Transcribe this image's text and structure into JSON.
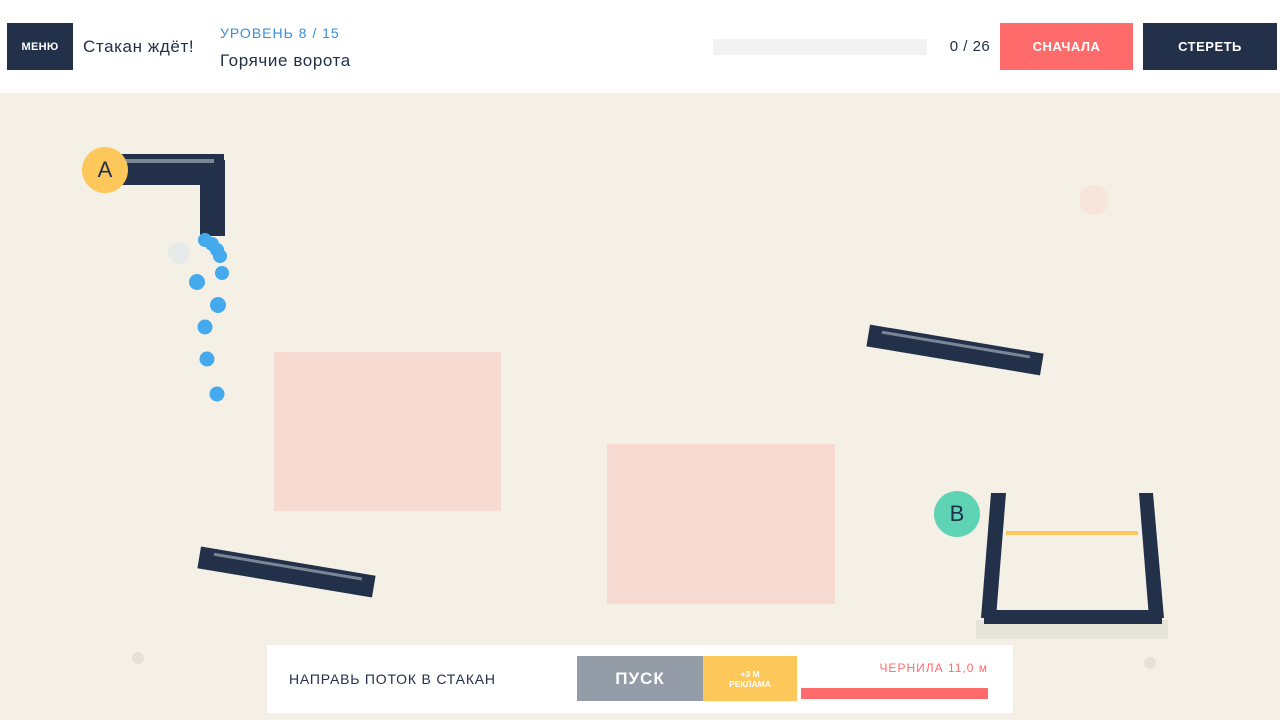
{
  "header": {
    "menu_label": "МЕНЮ",
    "status_text": "Стакан ждёт!",
    "level_number": "УРОВЕНЬ 8 / 15",
    "level_name": "Горячие ворота",
    "progress": {
      "count_text": "0 / 26",
      "filled": 0,
      "total": 26
    },
    "restart_label": "СНАЧАЛА",
    "erase_label": "СТЕРЕТЬ"
  },
  "field": {
    "marker_a_label": "A",
    "marker_b_label": "B",
    "colors": {
      "background": "#f5f0e6",
      "solid": "#223049",
      "water": "#45a9ee",
      "heat_zone": "#f7dbd3",
      "goal_line": "#fdc75a"
    }
  },
  "bottom": {
    "instruction": "НАПРАВЬ ПОТОК В СТАКАН",
    "play_label": "ПУСК",
    "ad_line1": "+3 М",
    "ad_line2": "РЕКЛАМА",
    "ink_label": "ЧЕРНИЛА  11,0 м",
    "ink_fraction": 1.0
  },
  "colors": {
    "dark": "#223049",
    "accent_red": "#ff6b6b",
    "accent_yellow": "#fdc75a",
    "accent_teal": "#5fd4b4",
    "accent_blue": "#3a8fd6",
    "button_gray": "#939ca7"
  }
}
